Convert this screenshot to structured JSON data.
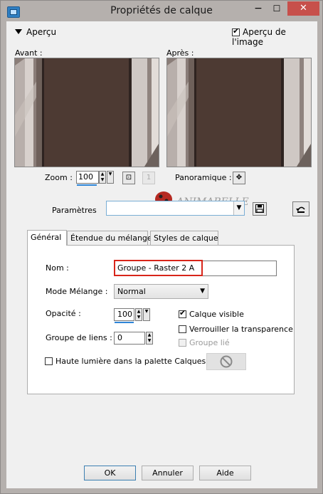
{
  "window": {
    "title": "Propriétés de calque",
    "min_symbol": "−",
    "max_symbol": "☐",
    "close_symbol": "✕"
  },
  "preview": {
    "section_label": "Aperçu",
    "show_preview_label": "Aperçu de l'image",
    "show_preview_checked": true,
    "before_label": "Avant :",
    "after_label": "Après :",
    "zoom_label": "Zoom :",
    "zoom_value": "100",
    "pan_label": "Panoramique :"
  },
  "watermark": {
    "text": "ANIMABELLE"
  },
  "params": {
    "label": "Paramètres",
    "value": ""
  },
  "tabs": [
    {
      "label": "Général",
      "active": true
    },
    {
      "label": "Étendue du mélange",
      "active": false
    },
    {
      "label": "Styles de calque",
      "active": false
    }
  ],
  "general": {
    "name_label": "Nom :",
    "name_value": "Groupe - Raster 2 A",
    "blend_label": "Mode Mélange :",
    "blend_value": "Normal",
    "opacity_label": "Opacité :",
    "opacity_value": "100",
    "link_group_label": "Groupe de liens :",
    "link_group_value": "0",
    "visible_label": "Calque visible",
    "visible_checked": true,
    "lock_label": "Verrouiller la transparence",
    "lock_checked": false,
    "group_linked_label": "Groupe lié",
    "group_linked_checked": false,
    "highlight_label": "Haute lumière dans la palette Calques :",
    "highlight_checked": false
  },
  "footer": {
    "ok": "OK",
    "cancel": "Annuler",
    "help": "Aide"
  },
  "colors": {
    "preview_brown": "#4d3a33",
    "highlight_red": "#d8251a",
    "titlebar": "#b5b0ad",
    "close_red": "#c7504b"
  }
}
